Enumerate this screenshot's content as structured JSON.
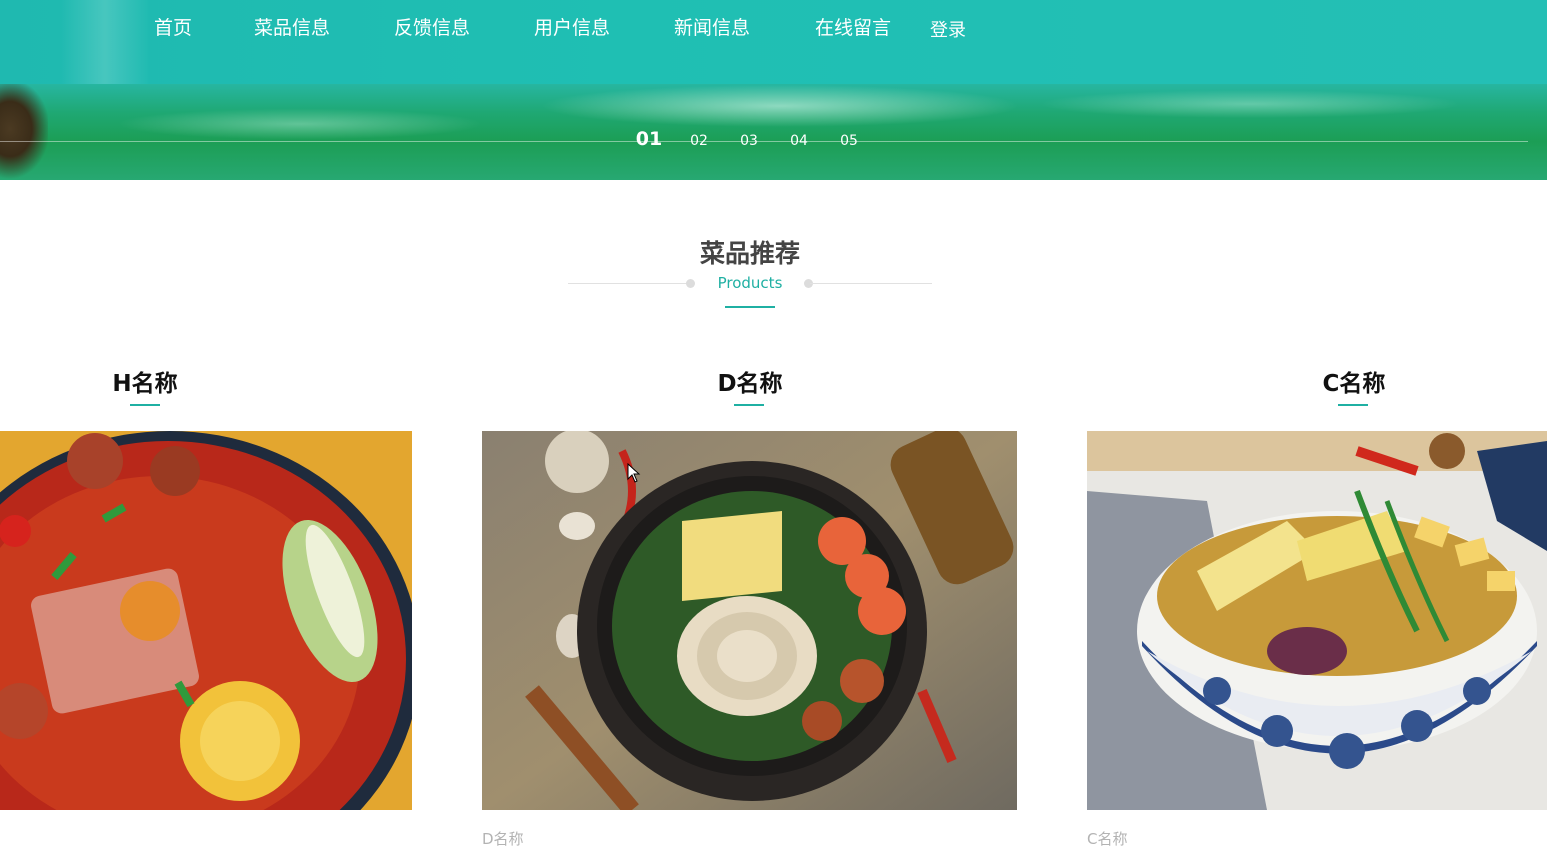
{
  "nav": {
    "items": [
      "首页",
      "菜品信息",
      "反馈信息",
      "用户信息",
      "新闻信息",
      "在线留言"
    ],
    "login": "登录"
  },
  "slider": {
    "dots": [
      "01",
      "02",
      "03",
      "04",
      "05"
    ],
    "active_index": 0
  },
  "section": {
    "title": "菜品推荐",
    "subtitle": "Products"
  },
  "products": [
    {
      "name": "H名称",
      "caption": ""
    },
    {
      "name": "D名称",
      "caption": "D名称"
    },
    {
      "name": "C名称",
      "caption": "C名称"
    }
  ],
  "colors": {
    "accent": "#1fb0a3",
    "nav_bg": "#1fbfb3",
    "title_text": "#444444"
  }
}
